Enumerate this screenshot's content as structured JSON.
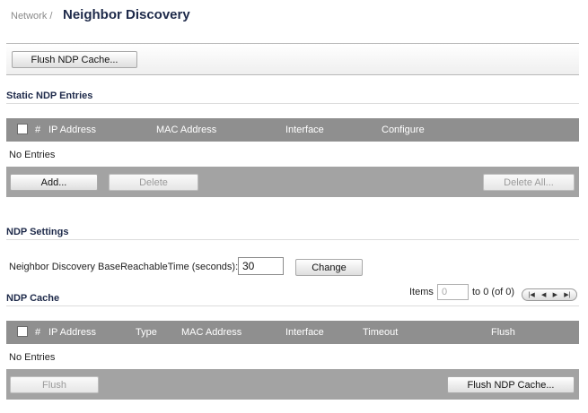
{
  "header": {
    "breadcrumb": "Network /",
    "title": "Neighbor Discovery"
  },
  "toolbar": {
    "flush_label": "Flush NDP Cache..."
  },
  "static_entries": {
    "title": "Static NDP Entries",
    "columns": [
      "#",
      "IP Address",
      "MAC Address",
      "Interface",
      "Configure"
    ],
    "empty_text": "No Entries",
    "add_label": "Add...",
    "delete_label": "Delete",
    "delete_all_label": "Delete All..."
  },
  "settings": {
    "title": "NDP Settings",
    "reachable_label": "Neighbor Discovery BaseReachableTime (seconds):",
    "reachable_value": "30",
    "change_label": "Change"
  },
  "cache": {
    "title": "NDP Cache",
    "items_label": "Items",
    "items_value": "0",
    "range_text": "to 0 (of 0)",
    "columns": [
      "#",
      "IP Address",
      "Type",
      "MAC Address",
      "Interface",
      "Timeout",
      "Flush"
    ],
    "empty_text": "No Entries",
    "flush_label": "Flush",
    "flush_cache_label": "Flush NDP Cache..."
  },
  "icons": {
    "first": "first-page-icon",
    "prev": "prev-page-icon",
    "next": "next-page-icon",
    "last": "last-page-icon"
  }
}
